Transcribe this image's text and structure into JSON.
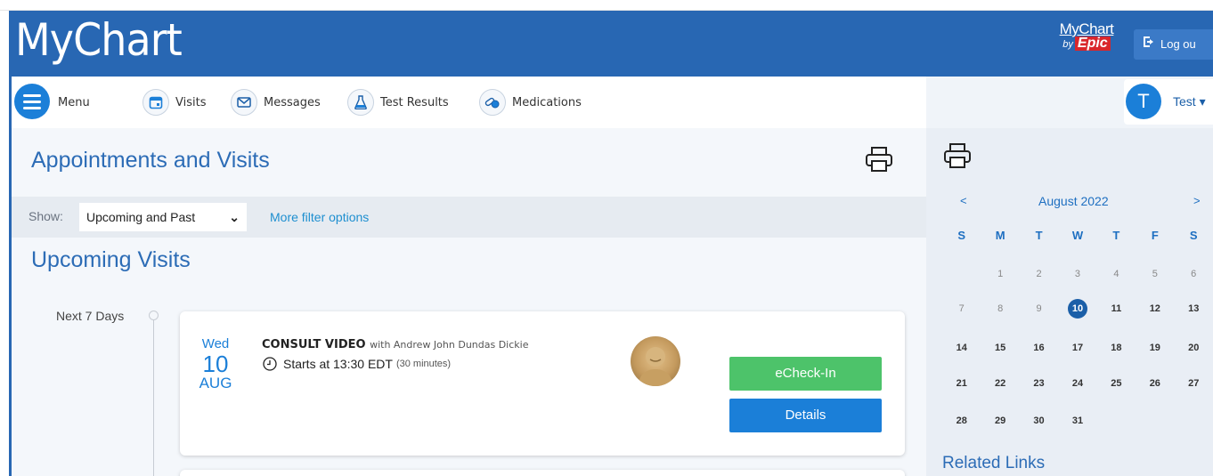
{
  "header": {
    "logo": "MyChart",
    "epic_top": "MyChart",
    "epic_by": "by",
    "epic_word": "Epic",
    "logout_label": "Log ou"
  },
  "nav": {
    "menu_label": "Menu",
    "items": [
      {
        "label": "Visits",
        "icon": "calendar-icon"
      },
      {
        "label": "Messages",
        "icon": "envelope-icon"
      },
      {
        "label": "Test Results",
        "icon": "flask-icon"
      },
      {
        "label": "Medications",
        "icon": "pills-icon"
      }
    ],
    "user_initial": "T",
    "user_name": "Test"
  },
  "main": {
    "title": "Appointments and Visits",
    "filter": {
      "show_label": "Show:",
      "selected": "Upcoming and Past",
      "more_label": "More filter options"
    },
    "section_title": "Upcoming Visits",
    "timeline_label": "Next 7 Days",
    "visit": {
      "day": "Wed",
      "date": "10",
      "month": "AUG",
      "type": "CONSULT VIDEO",
      "with": "with Andrew John Dundas Dickie",
      "time": "Starts at 13:30 EDT",
      "duration": "(30 minutes)",
      "checkin_label": "eCheck-In",
      "details_label": "Details"
    }
  },
  "calendar": {
    "title": "August 2022",
    "prev": "<",
    "next": ">",
    "weekdays": [
      "S",
      "M",
      "T",
      "W",
      "T",
      "F",
      "S"
    ],
    "weeks": [
      [
        "",
        "1",
        "2",
        "3",
        "4",
        "5",
        "6"
      ],
      [
        "7",
        "8",
        "9",
        "10",
        "11",
        "12",
        "13"
      ],
      [
        "14",
        "15",
        "16",
        "17",
        "18",
        "19",
        "20"
      ],
      [
        "21",
        "22",
        "23",
        "24",
        "25",
        "26",
        "27"
      ],
      [
        "28",
        "29",
        "30",
        "31",
        "",
        "",
        ""
      ]
    ],
    "today": "10"
  },
  "related_links": "Related Links",
  "colors": {
    "brand_blue": "#2867b3",
    "accent_blue": "#1b7fd8",
    "checkin_green": "#4dc36a",
    "epic_red": "#d9262b"
  }
}
